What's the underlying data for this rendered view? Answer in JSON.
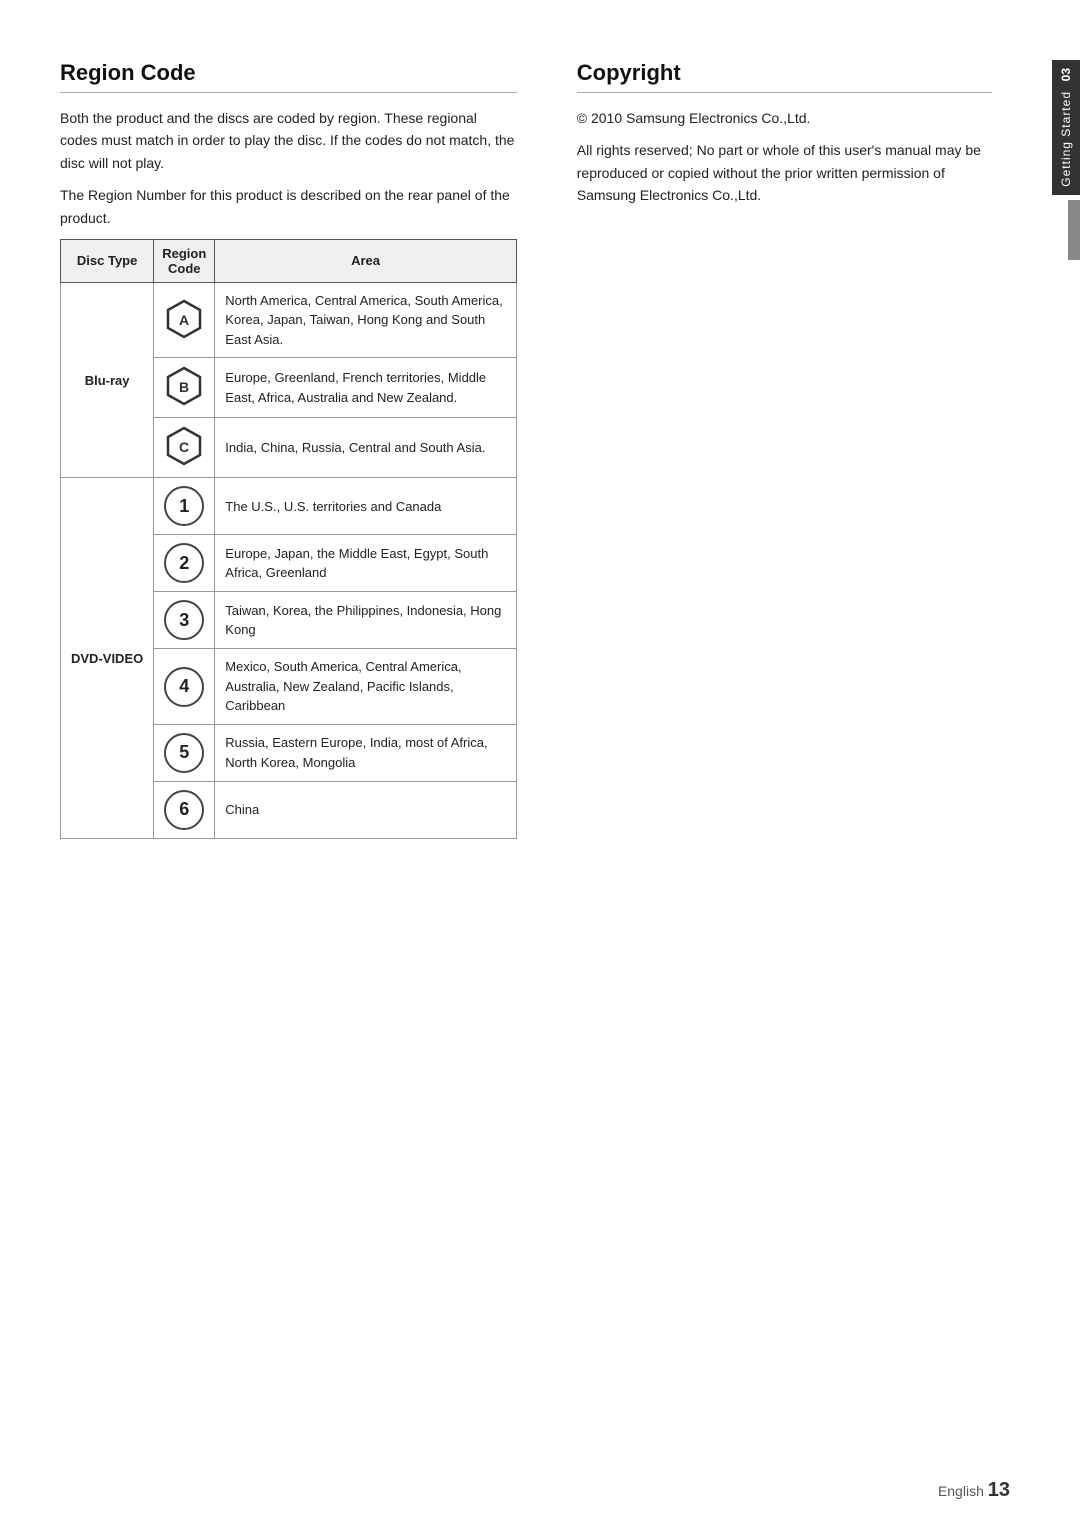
{
  "left_section": {
    "title": "Region Code",
    "intro_text_1": "Both the product and the discs are coded by region. These regional codes must match in order to play the disc. If the codes do not match, the disc will not play.",
    "intro_text_2": "The Region Number for this product is described on the rear panel of the product.",
    "table": {
      "headers": [
        "Disc Type",
        "Region Code",
        "Area"
      ],
      "rows": [
        {
          "disc_type": "Blu-ray",
          "disc_type_span": 3,
          "entries": [
            {
              "icon_type": "hex",
              "icon_label": "A",
              "area": "North America, Central America, South America, Korea, Japan, Taiwan, Hong Kong and South East Asia."
            },
            {
              "icon_type": "hex",
              "icon_label": "B",
              "area": "Europe, Greenland, French territories, Middle East, Africa, Australia and New Zealand."
            },
            {
              "icon_type": "hex",
              "icon_label": "C",
              "area": "India, China, Russia, Central and South Asia."
            }
          ]
        },
        {
          "disc_type": "DVD-VIDEO",
          "disc_type_span": 6,
          "entries": [
            {
              "icon_type": "circle",
              "icon_label": "1",
              "area": "The U.S., U.S. territories and Canada"
            },
            {
              "icon_type": "circle",
              "icon_label": "2",
              "area": "Europe, Japan, the Middle East, Egypt, South Africa, Greenland"
            },
            {
              "icon_type": "circle",
              "icon_label": "3",
              "area": "Taiwan, Korea, the Philippines, Indonesia, Hong Kong"
            },
            {
              "icon_type": "circle",
              "icon_label": "4",
              "area": "Mexico, South America, Central America, Australia, New Zealand, Pacific Islands, Caribbean"
            },
            {
              "icon_type": "circle",
              "icon_label": "5",
              "area": "Russia, Eastern Europe, India, most of Africa, North Korea, Mongolia"
            },
            {
              "icon_type": "circle",
              "icon_label": "6",
              "area": "China"
            }
          ]
        }
      ]
    }
  },
  "right_section": {
    "title": "Copyright",
    "copyright_line": "© 2010 Samsung Electronics Co.,Ltd.",
    "rights_text": "All rights reserved; No part or whole of this user's manual may be reproduced or copied without the prior written permission of Samsung Electronics Co.,Ltd."
  },
  "sidebar": {
    "chapter_number": "03",
    "chapter_title": "Getting Started"
  },
  "footer": {
    "language": "English",
    "page_number": "13"
  }
}
